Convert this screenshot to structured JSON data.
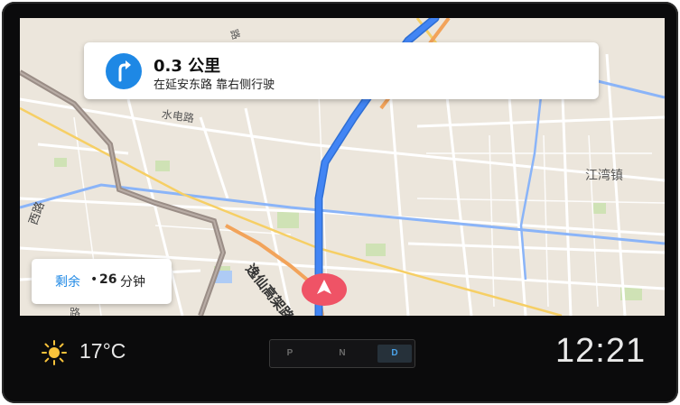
{
  "navigation": {
    "distance": "0.3 公里",
    "instruction": "在延安东路 靠右侧行驶",
    "turn_icon": "turn-right-arrow-icon",
    "accent_color": "#1e88e5"
  },
  "map": {
    "labels": {
      "water_road": "水电路",
      "jiangwan": "江湾镇",
      "yixian": "逸仙高架路",
      "road_left": "西路",
      "road_left_lower": "路",
      "road_top": "路"
    },
    "route_color": "#4285f4",
    "cursor_color": "#ef5366"
  },
  "remaining": {
    "label": "剩余",
    "separator": "•",
    "value": "26",
    "unit": "分钟"
  },
  "status_bar": {
    "weather_icon": "sun-icon",
    "temperature": "17°C",
    "gears": [
      "P",
      "N",
      "D"
    ],
    "active_gear": "D",
    "time": "12:21"
  }
}
